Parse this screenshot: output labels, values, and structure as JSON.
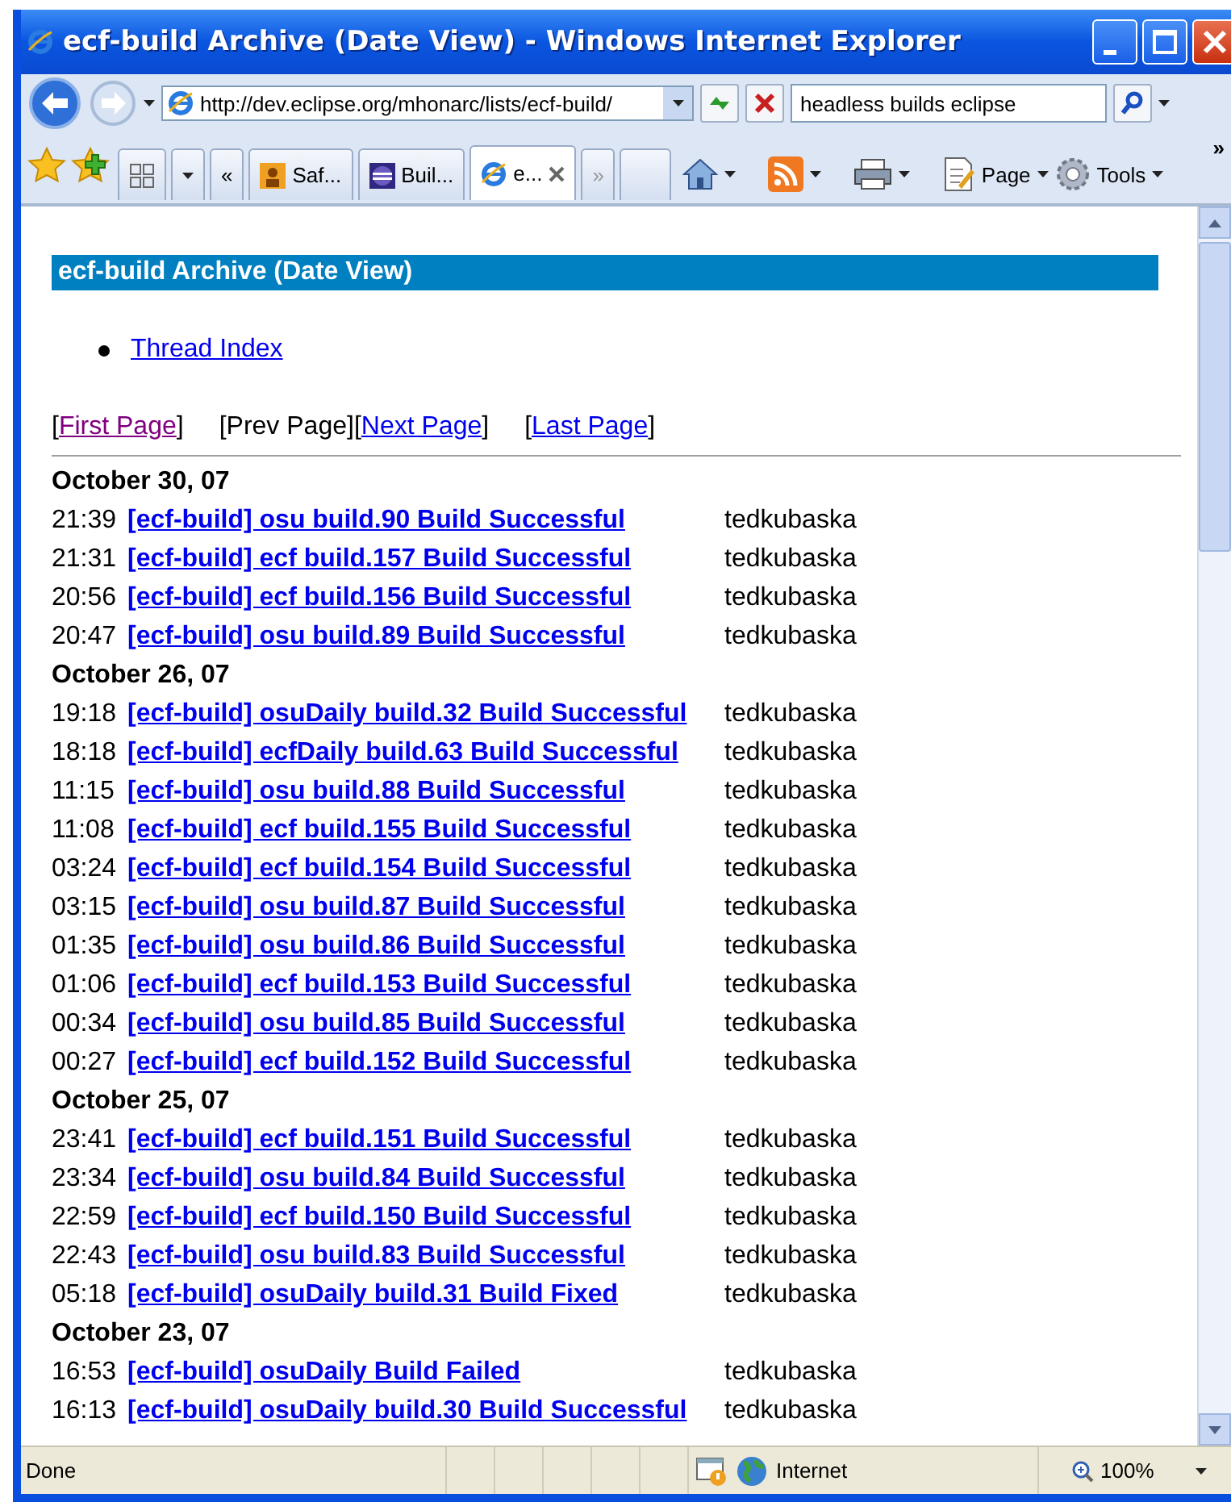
{
  "window": {
    "title": "ecf-build Archive (Date View) - Windows Internet Explorer"
  },
  "address_bar": {
    "url": "http://dev.eclipse.org/mhonarc/lists/ecf-build/"
  },
  "search": {
    "value": "headless builds eclipse"
  },
  "tabs": [
    {
      "label": "Saf...",
      "selected": false
    },
    {
      "label": "Buil...",
      "selected": false
    },
    {
      "label": "e...",
      "selected": true
    }
  ],
  "command_bar": {
    "tabs_overflow": "»",
    "tabs_back": "«",
    "page_menu": "Page",
    "tools_menu": "Tools",
    "more": "»"
  },
  "page": {
    "heading": "ecf-build Archive (Date View)",
    "links": [
      "Thread Index"
    ],
    "pager": [
      {
        "before": "[",
        "label": "First Page",
        "after": "]",
        "kind": "link",
        "visited": true
      },
      {
        "before": "[",
        "label": "Prev Page",
        "after": "]",
        "kind": "text"
      },
      {
        "before": "[",
        "label": "Next Page",
        "after": "]",
        "kind": "link",
        "visited": false
      },
      {
        "before": "[",
        "label": "Last Page",
        "after": "]",
        "kind": "link",
        "visited": false
      }
    ],
    "days": [
      {
        "date": "October 30, 07",
        "messages": [
          {
            "time": "21:39",
            "subject": "[ecf-build] osu build.90 Build Successful",
            "author": "tedkubaska"
          },
          {
            "time": "21:31",
            "subject": "[ecf-build] ecf build.157 Build Successful",
            "author": "tedkubaska"
          },
          {
            "time": "20:56",
            "subject": "[ecf-build] ecf build.156 Build Successful",
            "author": "tedkubaska"
          },
          {
            "time": "20:47",
            "subject": "[ecf-build] osu build.89 Build Successful",
            "author": "tedkubaska"
          }
        ]
      },
      {
        "date": "October 26, 07",
        "messages": [
          {
            "time": "19:18",
            "subject": "[ecf-build] osuDaily build.32 Build Successful",
            "author": "tedkubaska"
          },
          {
            "time": "18:18",
            "subject": "[ecf-build] ecfDaily build.63 Build Successful",
            "author": "tedkubaska"
          },
          {
            "time": "11:15",
            "subject": "[ecf-build] osu build.88 Build Successful",
            "author": "tedkubaska"
          },
          {
            "time": "11:08",
            "subject": "[ecf-build] ecf build.155 Build Successful",
            "author": "tedkubaska"
          },
          {
            "time": "03:24",
            "subject": "[ecf-build] ecf build.154 Build Successful",
            "author": "tedkubaska"
          },
          {
            "time": "03:15",
            "subject": "[ecf-build] osu build.87 Build Successful",
            "author": "tedkubaska"
          },
          {
            "time": "01:35",
            "subject": "[ecf-build] osu build.86 Build Successful",
            "author": "tedkubaska"
          },
          {
            "time": "01:06",
            "subject": "[ecf-build] ecf build.153 Build Successful",
            "author": "tedkubaska"
          },
          {
            "time": "00:34",
            "subject": "[ecf-build] osu build.85 Build Successful",
            "author": "tedkubaska"
          },
          {
            "time": "00:27",
            "subject": "[ecf-build] ecf build.152 Build Successful",
            "author": "tedkubaska"
          }
        ]
      },
      {
        "date": "October 25, 07",
        "messages": [
          {
            "time": "23:41",
            "subject": "[ecf-build] ecf build.151 Build Successful",
            "author": "tedkubaska"
          },
          {
            "time": "23:34",
            "subject": "[ecf-build] osu build.84 Build Successful",
            "author": "tedkubaska"
          },
          {
            "time": "22:59",
            "subject": "[ecf-build] ecf build.150 Build Successful",
            "author": "tedkubaska"
          },
          {
            "time": "22:43",
            "subject": "[ecf-build] osu build.83 Build Successful",
            "author": "tedkubaska"
          },
          {
            "time": "05:18",
            "subject": "[ecf-build] osuDaily build.31 Build Fixed",
            "author": "tedkubaska"
          }
        ]
      },
      {
        "date": "October 23, 07",
        "messages": [
          {
            "time": "16:53",
            "subject": "[ecf-build] osuDaily Build Failed",
            "author": "tedkubaska"
          },
          {
            "time": "16:13",
            "subject": "[ecf-build] osuDaily build.30 Build Successful",
            "author": "tedkubaska"
          }
        ]
      }
    ]
  },
  "status_bar": {
    "text": "Done",
    "zone": "Internet",
    "zoom": "100%"
  }
}
